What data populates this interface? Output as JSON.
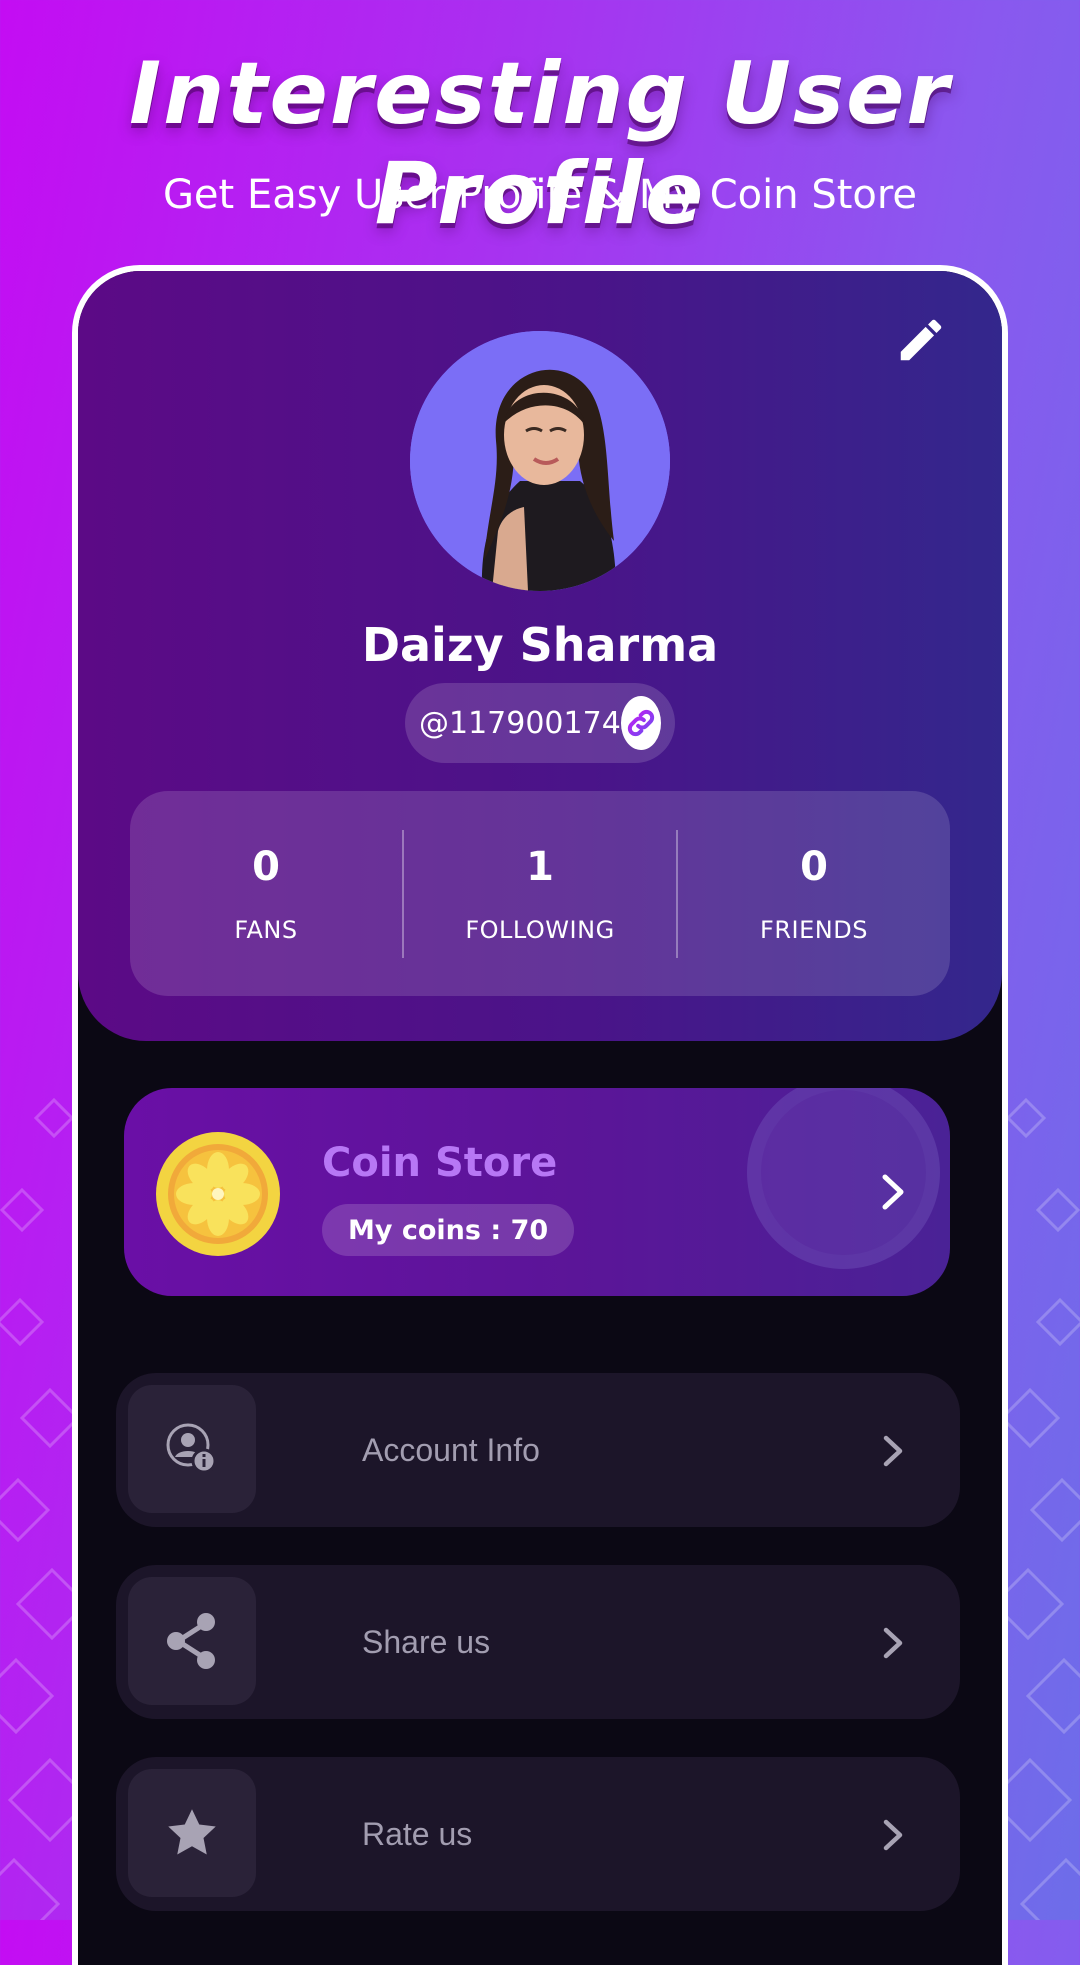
{
  "banner": {
    "title": "Interesting User Profile",
    "subtitle": "Get Easy User Profile & My Coin Store"
  },
  "profile": {
    "name": "Daizy Sharma",
    "handle": "@117900174",
    "stats": [
      {
        "value": "0",
        "label": "FANS"
      },
      {
        "value": "1",
        "label": "FOLLOWING"
      },
      {
        "value": "0",
        "label": "FRIENDS"
      }
    ]
  },
  "coin_store": {
    "title": "Coin Store",
    "coins_text": "My coins : 70"
  },
  "menu": [
    {
      "label": "Account Info",
      "icon": "account-info-icon"
    },
    {
      "label": "Share us",
      "icon": "share-icon"
    },
    {
      "label": "Rate us",
      "icon": "star-icon"
    }
  ],
  "colors": {
    "background_start": "#c40cf3",
    "background_end": "#6d6de9",
    "header_panel": "#4a1489",
    "coin_title": "#b777f5",
    "menu_item_bg": "#1c1529",
    "app_bg": "#0b0814"
  }
}
